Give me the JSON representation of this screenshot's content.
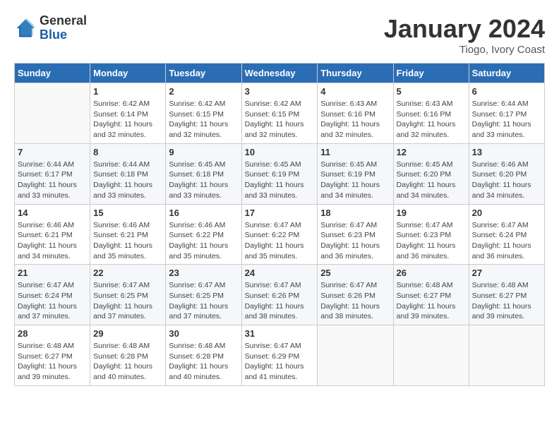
{
  "header": {
    "logo_general": "General",
    "logo_blue": "Blue",
    "month": "January 2024",
    "location": "Tiogo, Ivory Coast"
  },
  "days_of_week": [
    "Sunday",
    "Monday",
    "Tuesday",
    "Wednesday",
    "Thursday",
    "Friday",
    "Saturday"
  ],
  "weeks": [
    [
      {
        "day": "",
        "sunrise": "",
        "sunset": "",
        "daylight": ""
      },
      {
        "day": "1",
        "sunrise": "Sunrise: 6:42 AM",
        "sunset": "Sunset: 6:14 PM",
        "daylight": "Daylight: 11 hours and 32 minutes."
      },
      {
        "day": "2",
        "sunrise": "Sunrise: 6:42 AM",
        "sunset": "Sunset: 6:15 PM",
        "daylight": "Daylight: 11 hours and 32 minutes."
      },
      {
        "day": "3",
        "sunrise": "Sunrise: 6:42 AM",
        "sunset": "Sunset: 6:15 PM",
        "daylight": "Daylight: 11 hours and 32 minutes."
      },
      {
        "day": "4",
        "sunrise": "Sunrise: 6:43 AM",
        "sunset": "Sunset: 6:16 PM",
        "daylight": "Daylight: 11 hours and 32 minutes."
      },
      {
        "day": "5",
        "sunrise": "Sunrise: 6:43 AM",
        "sunset": "Sunset: 6:16 PM",
        "daylight": "Daylight: 11 hours and 32 minutes."
      },
      {
        "day": "6",
        "sunrise": "Sunrise: 6:44 AM",
        "sunset": "Sunset: 6:17 PM",
        "daylight": "Daylight: 11 hours and 33 minutes."
      }
    ],
    [
      {
        "day": "7",
        "sunrise": "Sunrise: 6:44 AM",
        "sunset": "Sunset: 6:17 PM",
        "daylight": "Daylight: 11 hours and 33 minutes."
      },
      {
        "day": "8",
        "sunrise": "Sunrise: 6:44 AM",
        "sunset": "Sunset: 6:18 PM",
        "daylight": "Daylight: 11 hours and 33 minutes."
      },
      {
        "day": "9",
        "sunrise": "Sunrise: 6:45 AM",
        "sunset": "Sunset: 6:18 PM",
        "daylight": "Daylight: 11 hours and 33 minutes."
      },
      {
        "day": "10",
        "sunrise": "Sunrise: 6:45 AM",
        "sunset": "Sunset: 6:19 PM",
        "daylight": "Daylight: 11 hours and 33 minutes."
      },
      {
        "day": "11",
        "sunrise": "Sunrise: 6:45 AM",
        "sunset": "Sunset: 6:19 PM",
        "daylight": "Daylight: 11 hours and 34 minutes."
      },
      {
        "day": "12",
        "sunrise": "Sunrise: 6:45 AM",
        "sunset": "Sunset: 6:20 PM",
        "daylight": "Daylight: 11 hours and 34 minutes."
      },
      {
        "day": "13",
        "sunrise": "Sunrise: 6:46 AM",
        "sunset": "Sunset: 6:20 PM",
        "daylight": "Daylight: 11 hours and 34 minutes."
      }
    ],
    [
      {
        "day": "14",
        "sunrise": "Sunrise: 6:46 AM",
        "sunset": "Sunset: 6:21 PM",
        "daylight": "Daylight: 11 hours and 34 minutes."
      },
      {
        "day": "15",
        "sunrise": "Sunrise: 6:46 AM",
        "sunset": "Sunset: 6:21 PM",
        "daylight": "Daylight: 11 hours and 35 minutes."
      },
      {
        "day": "16",
        "sunrise": "Sunrise: 6:46 AM",
        "sunset": "Sunset: 6:22 PM",
        "daylight": "Daylight: 11 hours and 35 minutes."
      },
      {
        "day": "17",
        "sunrise": "Sunrise: 6:47 AM",
        "sunset": "Sunset: 6:22 PM",
        "daylight": "Daylight: 11 hours and 35 minutes."
      },
      {
        "day": "18",
        "sunrise": "Sunrise: 6:47 AM",
        "sunset": "Sunset: 6:23 PM",
        "daylight": "Daylight: 11 hours and 36 minutes."
      },
      {
        "day": "19",
        "sunrise": "Sunrise: 6:47 AM",
        "sunset": "Sunset: 6:23 PM",
        "daylight": "Daylight: 11 hours and 36 minutes."
      },
      {
        "day": "20",
        "sunrise": "Sunrise: 6:47 AM",
        "sunset": "Sunset: 6:24 PM",
        "daylight": "Daylight: 11 hours and 36 minutes."
      }
    ],
    [
      {
        "day": "21",
        "sunrise": "Sunrise: 6:47 AM",
        "sunset": "Sunset: 6:24 PM",
        "daylight": "Daylight: 11 hours and 37 minutes."
      },
      {
        "day": "22",
        "sunrise": "Sunrise: 6:47 AM",
        "sunset": "Sunset: 6:25 PM",
        "daylight": "Daylight: 11 hours and 37 minutes."
      },
      {
        "day": "23",
        "sunrise": "Sunrise: 6:47 AM",
        "sunset": "Sunset: 6:25 PM",
        "daylight": "Daylight: 11 hours and 37 minutes."
      },
      {
        "day": "24",
        "sunrise": "Sunrise: 6:47 AM",
        "sunset": "Sunset: 6:26 PM",
        "daylight": "Daylight: 11 hours and 38 minutes."
      },
      {
        "day": "25",
        "sunrise": "Sunrise: 6:47 AM",
        "sunset": "Sunset: 6:26 PM",
        "daylight": "Daylight: 11 hours and 38 minutes."
      },
      {
        "day": "26",
        "sunrise": "Sunrise: 6:48 AM",
        "sunset": "Sunset: 6:27 PM",
        "daylight": "Daylight: 11 hours and 39 minutes."
      },
      {
        "day": "27",
        "sunrise": "Sunrise: 6:48 AM",
        "sunset": "Sunset: 6:27 PM",
        "daylight": "Daylight: 11 hours and 39 minutes."
      }
    ],
    [
      {
        "day": "28",
        "sunrise": "Sunrise: 6:48 AM",
        "sunset": "Sunset: 6:27 PM",
        "daylight": "Daylight: 11 hours and 39 minutes."
      },
      {
        "day": "29",
        "sunrise": "Sunrise: 6:48 AM",
        "sunset": "Sunset: 6:28 PM",
        "daylight": "Daylight: 11 hours and 40 minutes."
      },
      {
        "day": "30",
        "sunrise": "Sunrise: 6:48 AM",
        "sunset": "Sunset: 6:28 PM",
        "daylight": "Daylight: 11 hours and 40 minutes."
      },
      {
        "day": "31",
        "sunrise": "Sunrise: 6:47 AM",
        "sunset": "Sunset: 6:29 PM",
        "daylight": "Daylight: 11 hours and 41 minutes."
      },
      {
        "day": "",
        "sunrise": "",
        "sunset": "",
        "daylight": ""
      },
      {
        "day": "",
        "sunrise": "",
        "sunset": "",
        "daylight": ""
      },
      {
        "day": "",
        "sunrise": "",
        "sunset": "",
        "daylight": ""
      }
    ]
  ]
}
